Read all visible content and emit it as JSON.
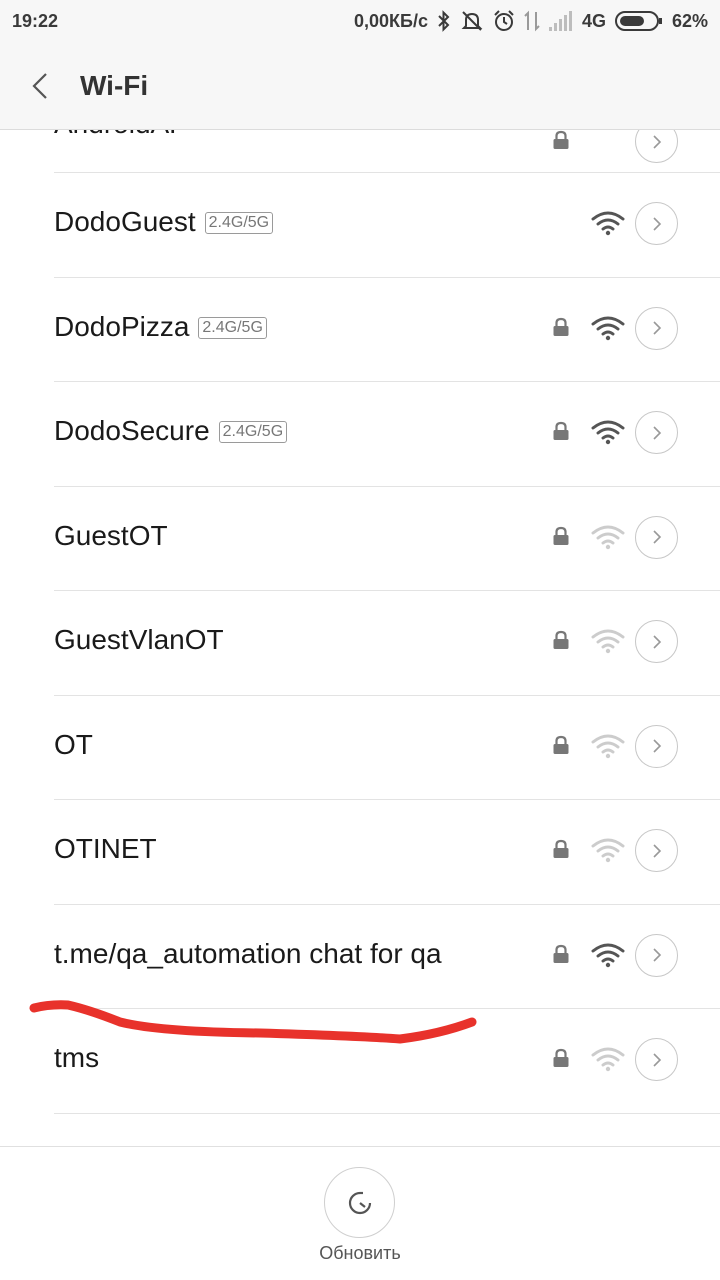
{
  "status_bar": {
    "time": "19:22",
    "speed": "0,00КБ/с",
    "network": "4G",
    "battery": "62%",
    "icons": [
      "bluetooth-icon",
      "mute-icon",
      "alarm-icon",
      "data-arrows-icon",
      "signal-icon",
      "battery-icon"
    ]
  },
  "header": {
    "title": "Wi-Fi"
  },
  "partial_network": {
    "name": "AndroidAP"
  },
  "networks": [
    {
      "name": "DodoGuest",
      "tag": "2.4G/5G",
      "locked": false,
      "signal": "strong"
    },
    {
      "name": "DodoPizza",
      "tag": "2.4G/5G",
      "locked": true,
      "signal": "strong"
    },
    {
      "name": "DodoSecure",
      "tag": "2.4G/5G",
      "locked": true,
      "signal": "strong"
    },
    {
      "name": "GuestOT",
      "tag": "",
      "locked": true,
      "signal": "weak"
    },
    {
      "name": "GuestVlanOT",
      "tag": "",
      "locked": true,
      "signal": "weak"
    },
    {
      "name": "OT",
      "tag": "",
      "locked": true,
      "signal": "weak"
    },
    {
      "name": "OTINET",
      "tag": "",
      "locked": true,
      "signal": "weak"
    },
    {
      "name": "t.me/qa_automation chat for qa",
      "tag": "",
      "locked": true,
      "signal": "strong"
    },
    {
      "name": "tms",
      "tag": "",
      "locked": true,
      "signal": "weak"
    }
  ],
  "bottom": {
    "refresh_label": "Обновить"
  },
  "colors": {
    "background": "#ffffff",
    "bar_background": "#f7f7f7",
    "icon_strong": "#555555",
    "icon_weak": "#cccccc",
    "annotation": "#e8322b"
  }
}
